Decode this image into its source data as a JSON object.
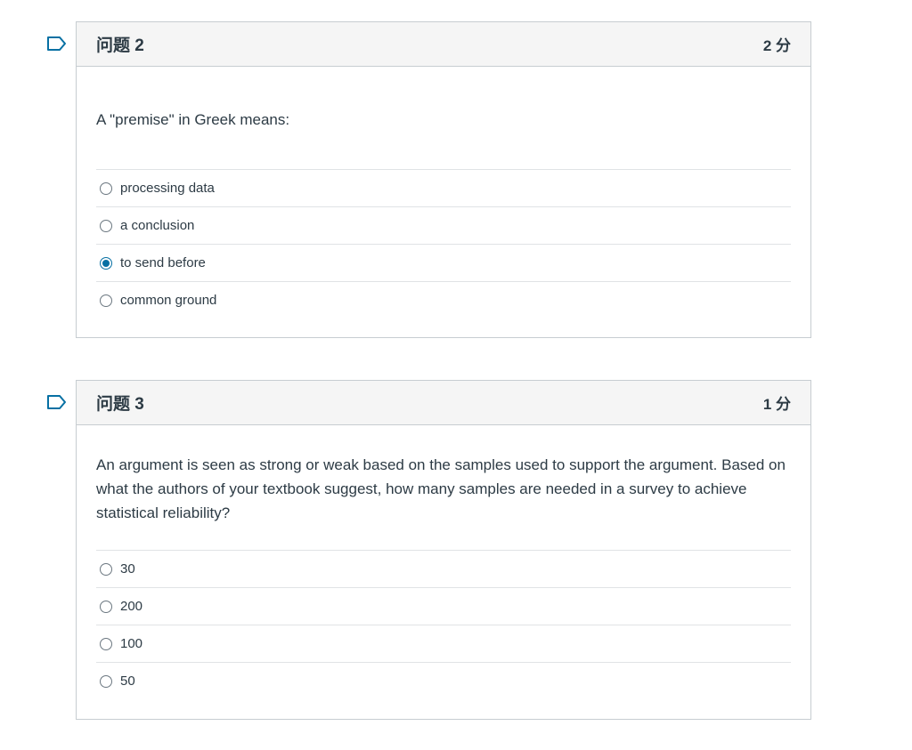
{
  "questions": [
    {
      "name": "问题 2",
      "points": "2 分",
      "text": "A \"premise\" in Greek means:",
      "answers": [
        {
          "label": "processing data",
          "selected": false
        },
        {
          "label": "a conclusion",
          "selected": false
        },
        {
          "label": "to send before",
          "selected": true
        },
        {
          "label": "common ground",
          "selected": false
        }
      ]
    },
    {
      "name": "问题 3",
      "points": "1 分",
      "text": "An argument is seen as strong or weak based on the samples used to support the argument. Based on what the authors of your textbook suggest, how many samples are needed in a survey to achieve statistical reliability?",
      "answers": [
        {
          "label": "30",
          "selected": false
        },
        {
          "label": "200",
          "selected": false
        },
        {
          "label": "100",
          "selected": false
        },
        {
          "label": "50",
          "selected": false
        }
      ]
    }
  ],
  "colors": {
    "accent": "#0770a3",
    "flag": "#0770a3",
    "header_bg": "#f5f5f5",
    "border": "#c7cdd1"
  },
  "icons": {
    "flag": "bookmark-flag-icon",
    "radio": "radio-icon"
  }
}
